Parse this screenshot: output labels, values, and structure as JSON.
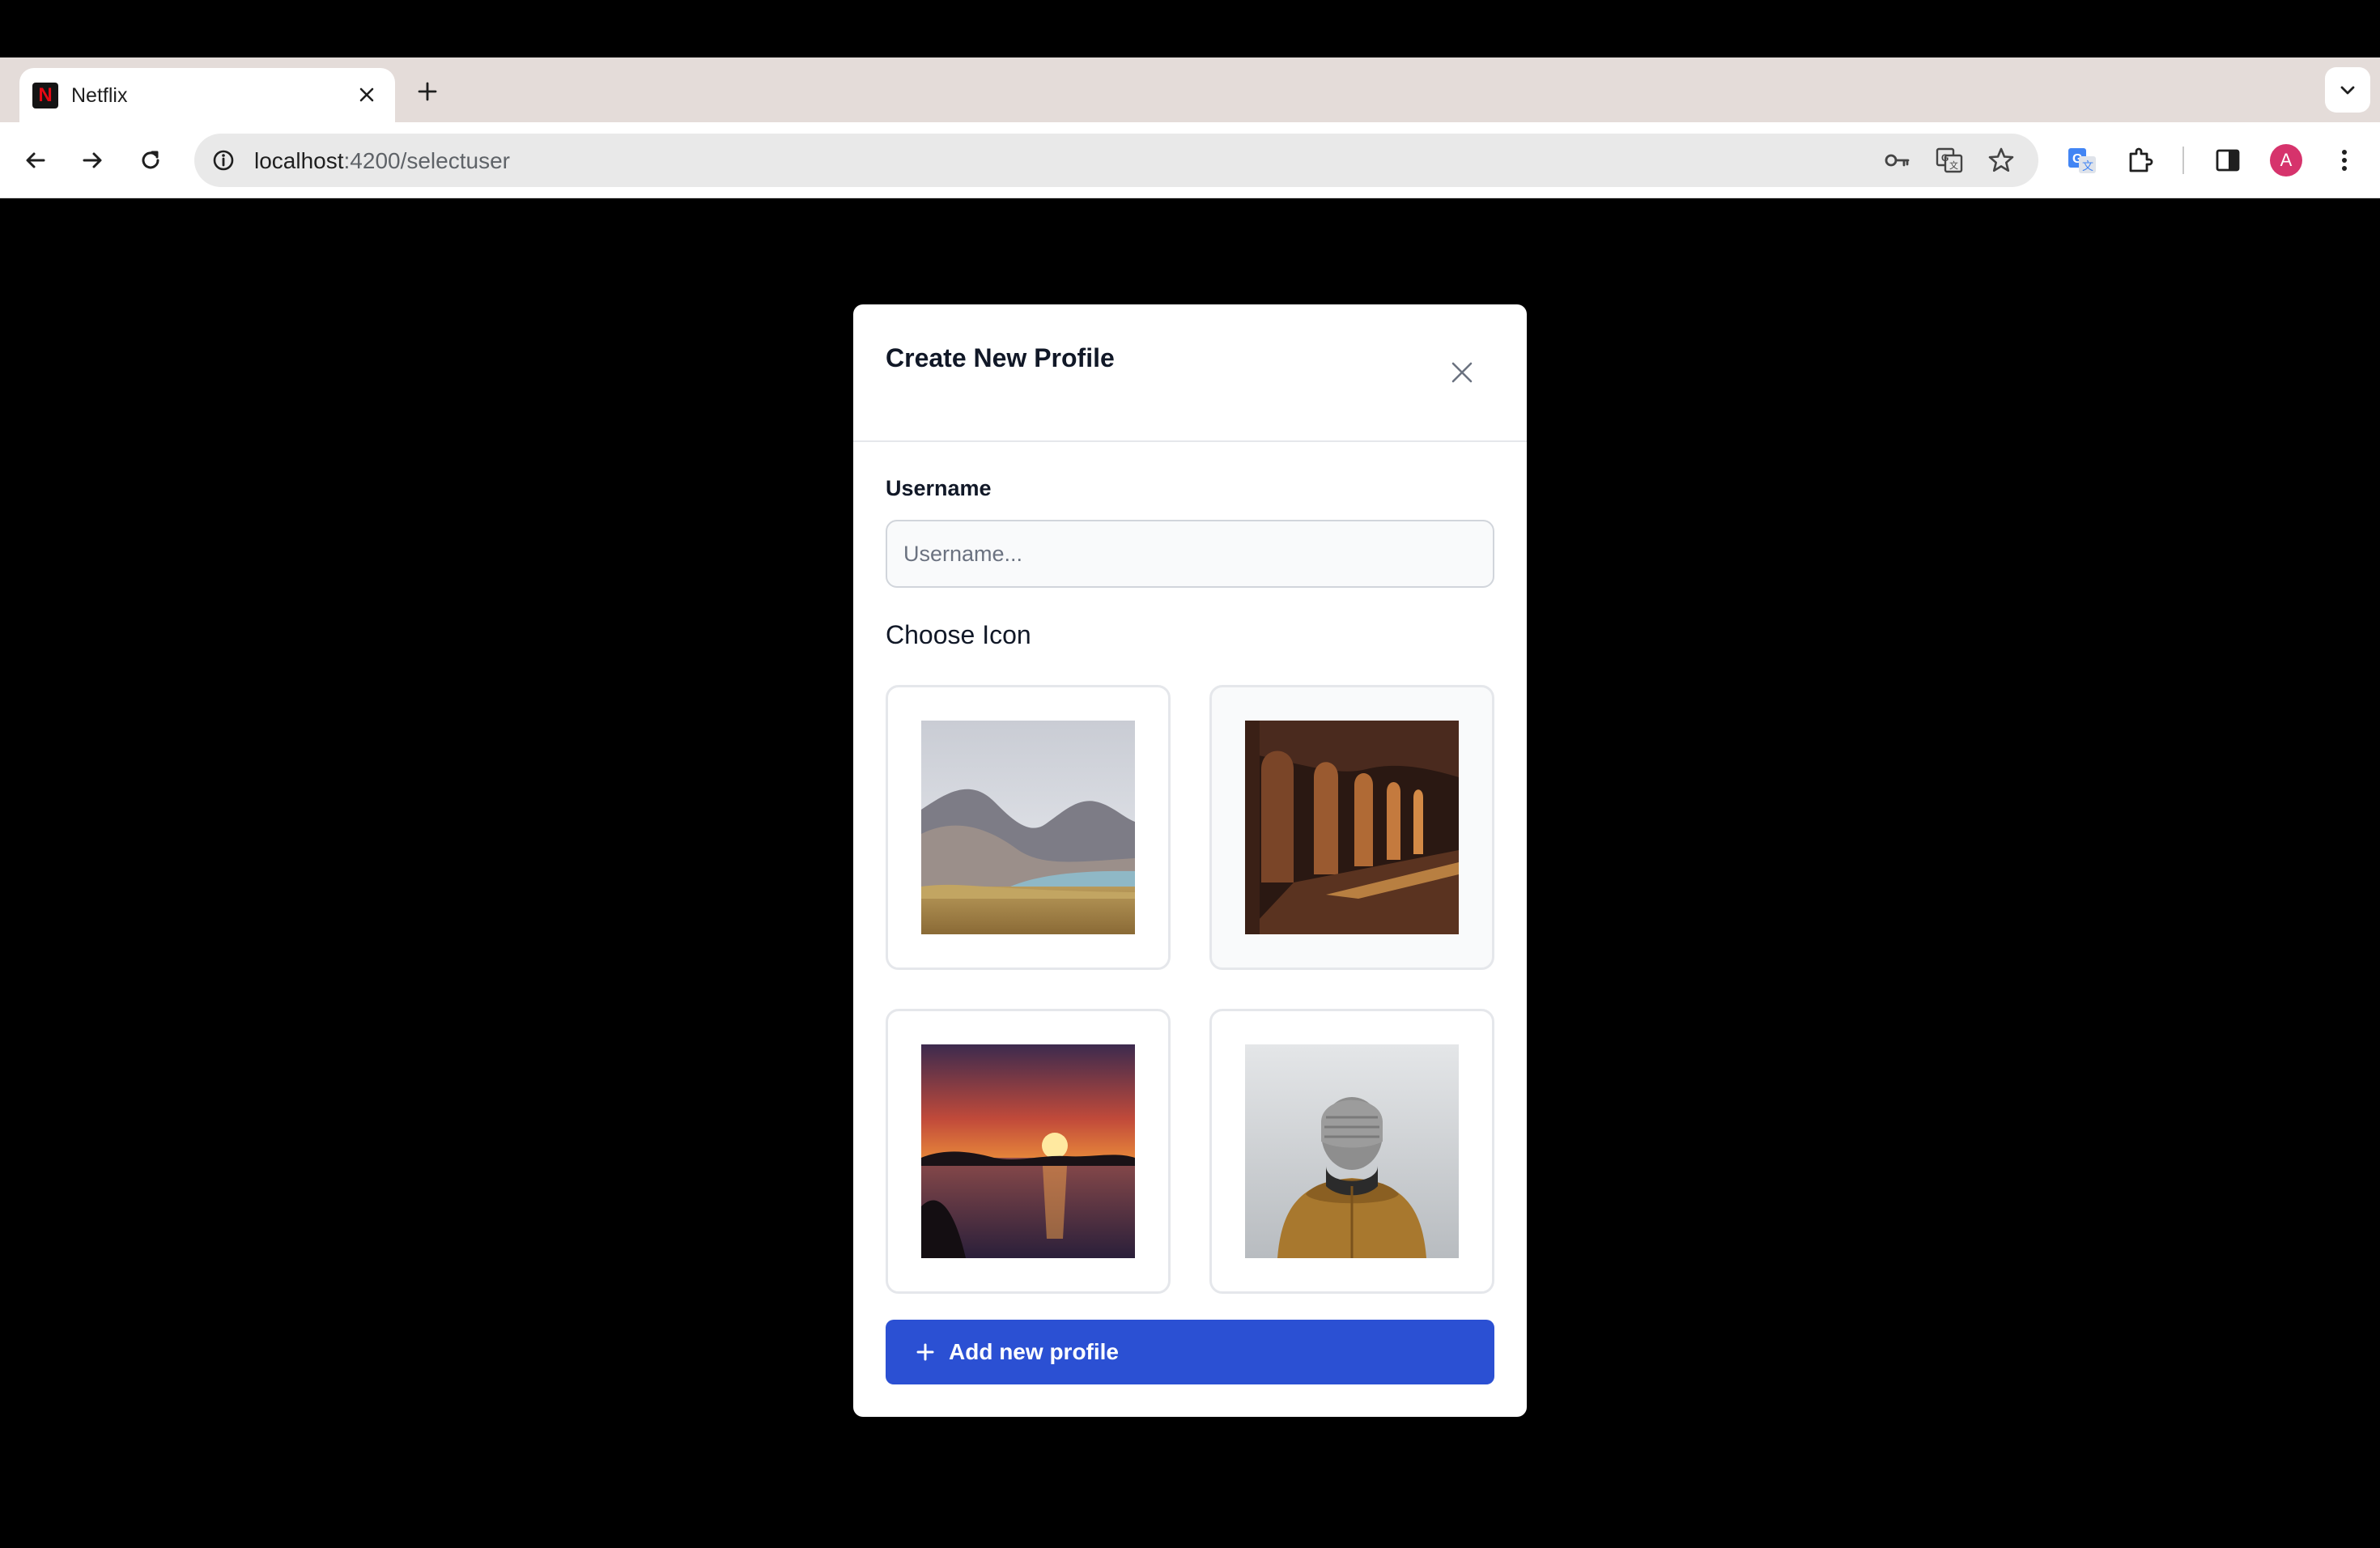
{
  "browser": {
    "tab": {
      "title": "Netflix",
      "favicon_letter": "N"
    },
    "url": {
      "host": "localhost",
      "path": ":4200/selectuser"
    },
    "profile_initial": "A"
  },
  "modal": {
    "title": "Create New Profile",
    "username": {
      "label": "Username",
      "placeholder": "Username...",
      "value": ""
    },
    "icons": {
      "label": "Choose Icon",
      "items": [
        {
          "name": "mountain-lake",
          "selected": false
        },
        {
          "name": "arched-corridor",
          "selected": true
        },
        {
          "name": "sunset-sea",
          "selected": false
        },
        {
          "name": "person-beanie",
          "selected": false
        }
      ]
    },
    "submit_label": "Add new profile"
  },
  "colors": {
    "primary_button": "#2b50d3",
    "tab_strip": "#e4dcd9",
    "avatar": "#d6336c",
    "netflix_red": "#e50914"
  }
}
